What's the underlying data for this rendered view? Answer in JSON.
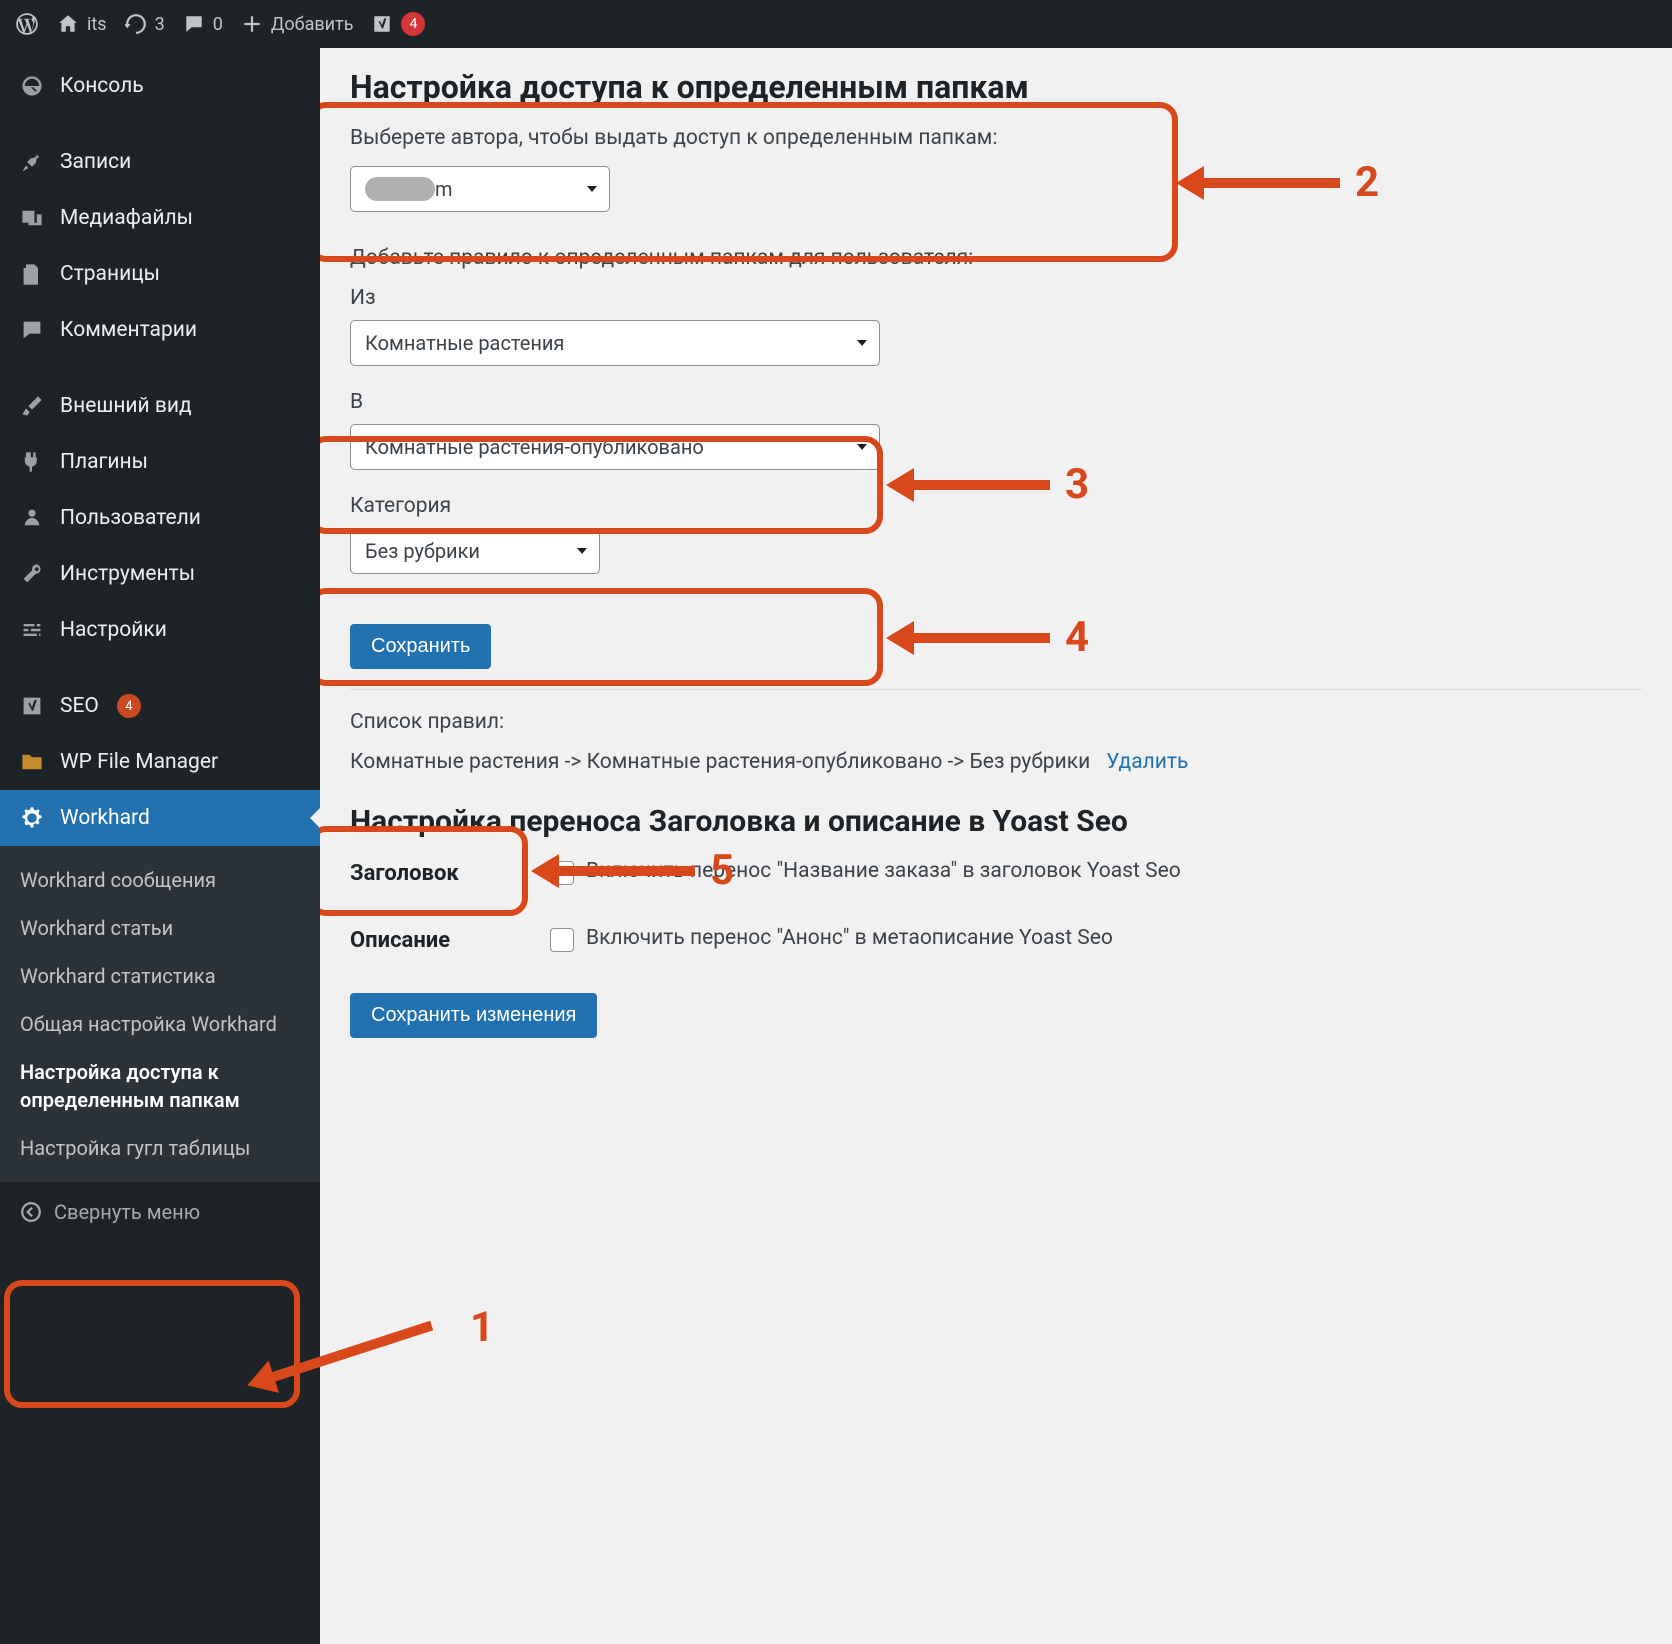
{
  "adminbar": {
    "site_name": "its",
    "updates_count": "3",
    "comments_count": "0",
    "add_new": "Добавить",
    "yoast_notifications": "4"
  },
  "sidebar": {
    "items": [
      {
        "label": "Консоль",
        "icon": "dashboard"
      },
      {
        "label": "Записи",
        "icon": "pin"
      },
      {
        "label": "Медиафайлы",
        "icon": "media"
      },
      {
        "label": "Страницы",
        "icon": "pages"
      },
      {
        "label": "Комментарии",
        "icon": "comments"
      },
      {
        "label": "Внешний вид",
        "icon": "appearance"
      },
      {
        "label": "Плагины",
        "icon": "plugins"
      },
      {
        "label": "Пользователи",
        "icon": "users"
      },
      {
        "label": "Инструменты",
        "icon": "tools"
      },
      {
        "label": "Настройки",
        "icon": "settings"
      },
      {
        "label": "SEO",
        "icon": "yoast",
        "badge": "4"
      },
      {
        "label": "WP File Manager",
        "icon": "folder"
      },
      {
        "label": "Workhard",
        "icon": "gear",
        "current": true
      }
    ],
    "submenu": [
      {
        "label": "Workhard сообщения"
      },
      {
        "label": "Workhard статьи"
      },
      {
        "label": "Workhard статистика"
      },
      {
        "label": "Общая настройка Workhard"
      },
      {
        "label": "Настройка доступа к определенным папкам",
        "current": true
      },
      {
        "label": "Настройка гугл таблицы"
      }
    ],
    "collapse": "Свернуть меню"
  },
  "page": {
    "title": "Настройка доступа к определенным папкам",
    "select_author_desc": "Выберете автора, чтобы выдать доступ к определенным папкам:",
    "author_value_suffix": "m",
    "add_rule_desc": "Добавьте правило к определенным папкам для пользователя:",
    "from_label": "Из",
    "from_value": "Комнатные растения",
    "to_label": "В",
    "to_value": "Комнатные растения-опубликовано",
    "category_label": "Категория",
    "category_value": "Без рубрики",
    "save_btn": "Сохранить",
    "rules_list_label": "Список правил:",
    "rule_text": "Комнатные растения -> Комнатные растения-опубликовано -> Без рубрики",
    "delete_link": "Удалить",
    "yoast_section_title": "Настройка переноса Заголовка и описание в Yoast Seo",
    "field_title": "Заголовок",
    "checkbox_title_label": "Включить перенос \"Название заказа\" в заголовок Yoast Seo",
    "field_desc": "Описание",
    "checkbox_desc_label": "Включить перенос \"Анонс\" в метаописание Yoast Seo",
    "save_changes_btn": "Сохранить изменения"
  },
  "annotations": {
    "n1": "1",
    "n2": "2",
    "n3": "3",
    "n4": "4",
    "n5": "5"
  }
}
